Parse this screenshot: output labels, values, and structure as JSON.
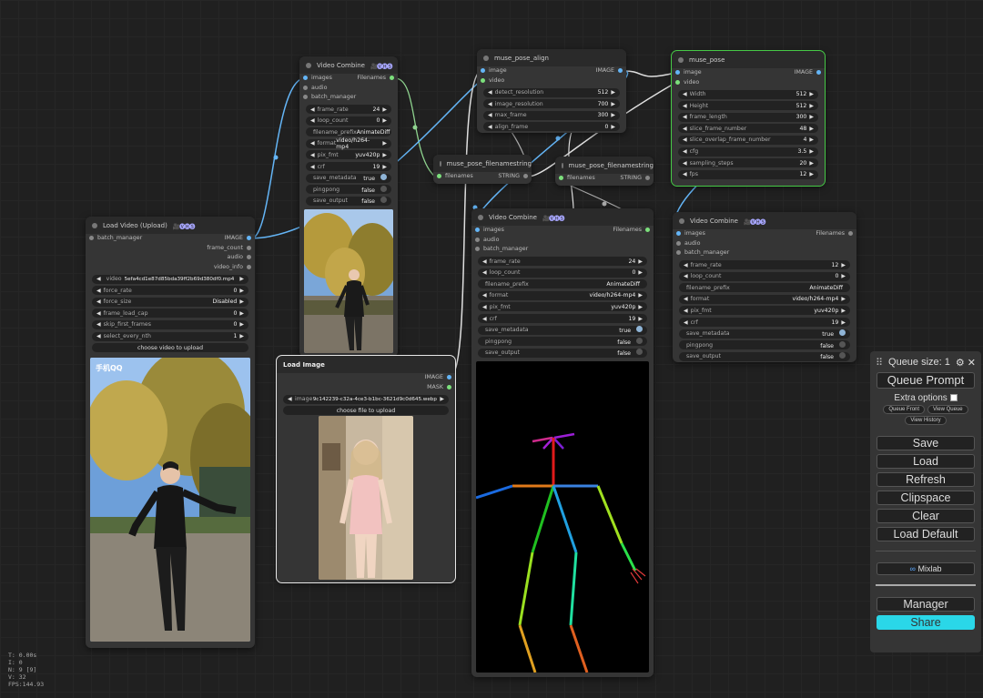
{
  "node_video_combine_1": {
    "title": "Video Combine",
    "badge": "🎥🅥🅗🅢",
    "inputs": [
      "images",
      "audio",
      "batch_manager"
    ],
    "output": "Filenames",
    "widgets": [
      {
        "label": "frame_rate",
        "value": "24"
      },
      {
        "label": "loop_count",
        "value": "0"
      },
      {
        "label": "filename_prefix",
        "value": "AnimateDiff"
      },
      {
        "label": "format",
        "value": "video/h264-mp4"
      },
      {
        "label": "pix_fmt",
        "value": "yuv420p"
      },
      {
        "label": "crf",
        "value": "19"
      },
      {
        "label": "save_metadata",
        "value": "true"
      },
      {
        "label": "pingpong",
        "value": "false"
      },
      {
        "label": "save_output",
        "value": "false"
      }
    ]
  },
  "node_muse_pose_align": {
    "title": "muse_pose_align",
    "inputs": [
      "image",
      "video"
    ],
    "output": "IMAGE",
    "widgets": [
      {
        "label": "detect_resolution",
        "value": "512"
      },
      {
        "label": "image_resolution",
        "value": "700"
      },
      {
        "label": "max_frame",
        "value": "300"
      },
      {
        "label": "align_frame",
        "value": "0"
      }
    ]
  },
  "node_muse_pose": {
    "title": "muse_pose",
    "inputs": [
      "image",
      "video"
    ],
    "output": "IMAGE",
    "widgets": [
      {
        "label": "Width",
        "value": "512"
      },
      {
        "label": "Height",
        "value": "512"
      },
      {
        "label": "frame_length",
        "value": "300"
      },
      {
        "label": "slice_frame_number",
        "value": "48"
      },
      {
        "label": "slice_overlap_frame_number",
        "value": "4"
      },
      {
        "label": "cfg",
        "value": "3.5"
      },
      {
        "label": "sampling_steps",
        "value": "20"
      },
      {
        "label": "fps",
        "value": "12"
      }
    ]
  },
  "node_filenamestring_1": {
    "title": "muse_pose_filenamestring",
    "input": "filenames",
    "output": "STRING"
  },
  "node_filenamestring_2": {
    "title": "muse_pose_filenamestring",
    "input": "filenames",
    "output": "STRING"
  },
  "node_load_video": {
    "title": "Load Video (Upload)",
    "badge": "🎥🅥🅗🅢",
    "input": "batch_manager",
    "outputs": [
      "IMAGE",
      "frame_count",
      "audio",
      "video_info"
    ],
    "widgets": [
      {
        "label": "video",
        "value": "5efa4cd1e87d85bda39ff2b69d380df0.mp4"
      },
      {
        "label": "force_rate",
        "value": "0"
      },
      {
        "label": "force_size",
        "value": "Disabled"
      },
      {
        "label": "frame_load_cap",
        "value": "0"
      },
      {
        "label": "skip_first_frames",
        "value": "0"
      },
      {
        "label": "select_every_nth",
        "value": "1"
      }
    ],
    "upload": "choose video to upload",
    "watermark": "手机QQ"
  },
  "node_load_image": {
    "title": "Load Image",
    "outputs": [
      "IMAGE",
      "MASK"
    ],
    "image_label": "image",
    "image_value": "9c142239-c32a-4ce3-b1bc-3621d9c0d645.webp",
    "upload": "choose file to upload"
  },
  "node_video_combine_2": {
    "title": "Video Combine",
    "badge": "🎥🅥🅗🅢",
    "inputs": [
      "images",
      "audio",
      "batch_manager"
    ],
    "output": "Filenames",
    "widgets": [
      {
        "label": "frame_rate",
        "value": "24"
      },
      {
        "label": "loop_count",
        "value": "0"
      },
      {
        "label": "filename_prefix",
        "value": "AnimateDiff"
      },
      {
        "label": "format",
        "value": "video/h264-mp4"
      },
      {
        "label": "pix_fmt",
        "value": "yuv420p"
      },
      {
        "label": "crf",
        "value": "19"
      },
      {
        "label": "save_metadata",
        "value": "true"
      },
      {
        "label": "pingpong",
        "value": "false"
      },
      {
        "label": "save_output",
        "value": "false"
      }
    ]
  },
  "node_video_combine_3": {
    "title": "Video Combine",
    "badge": "🎥🅥🅗🅢",
    "inputs": [
      "images",
      "audio",
      "batch_manager"
    ],
    "output": "Filenames",
    "widgets": [
      {
        "label": "frame_rate",
        "value": "12"
      },
      {
        "label": "loop_count",
        "value": "0"
      },
      {
        "label": "filename_prefix",
        "value": "AnimateDiff"
      },
      {
        "label": "format",
        "value": "video/h264-mp4"
      },
      {
        "label": "pix_fmt",
        "value": "yuv420p"
      },
      {
        "label": "crf",
        "value": "19"
      },
      {
        "label": "save_metadata",
        "value": "true"
      },
      {
        "label": "pingpong",
        "value": "false"
      },
      {
        "label": "save_output",
        "value": "false"
      }
    ]
  },
  "queue_panel": {
    "queue_size": "Queue size: 1",
    "queue_prompt": "Queue Prompt",
    "extra_options": "Extra options",
    "queue_front": "Queue Front",
    "view_queue": "View Queue",
    "view_history": "View History",
    "save": "Save",
    "load": "Load",
    "refresh": "Refresh",
    "clipspace": "Clipspace",
    "clear": "Clear",
    "load_default": "Load Default",
    "mixlab": "Mixlab",
    "manager": "Manager",
    "share": "Share"
  },
  "stats": [
    "T: 0.00s",
    "I: 0",
    "N: 9 [9]",
    "V: 32",
    "FPS:144.93"
  ],
  "colors": {
    "canvas": "#202020",
    "node": "#353535",
    "selected": "#46c846",
    "share": "#2ad7e8"
  }
}
